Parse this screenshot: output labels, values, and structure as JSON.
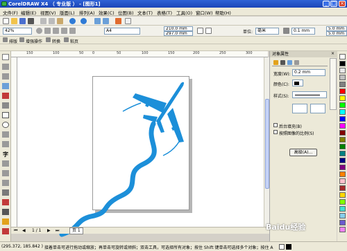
{
  "window": {
    "title": "CorelDRAW X4 （ 专业版 ） - [图形1]",
    "min": "_",
    "max": "□",
    "close": "×"
  },
  "menu": [
    "文件(F)",
    "编辑(E)",
    "视图(V)",
    "版面(L)",
    "排列(A)",
    "效果(C)",
    "位图(B)",
    "文本(T)",
    "表格(T)",
    "工具(O)",
    "窗口(W)",
    "帮助(H)"
  ],
  "toolbar2": {
    "zoom": "42%",
    "paper": "A4",
    "width": "210.0 mm",
    "height": "297.0 mm",
    "units_label": "单位:",
    "units": "毫米",
    "nudge": "0.1 mm",
    "dup_x": "5.0 mm",
    "dup_y": "5.0 mm"
  },
  "toolbar3": {
    "items": [
      "排版",
      "增强操作",
      "转换",
      "粘页"
    ]
  },
  "ruler_top": [
    "150",
    "100",
    "50",
    "0",
    "50",
    "100",
    "150",
    "200",
    "250",
    "300"
  ],
  "docker": {
    "title": "对象属性",
    "width_label": "宽度(W):",
    "width_value": "0.2 mm",
    "color_label": "颜色(C):",
    "style_label": "样式(S):",
    "checkbox1": "后台填充(B)",
    "checkbox2": "按照图像的比例(S)",
    "apply_button": "高级(A)..."
  },
  "page_nav": {
    "counter": "1 / 1",
    "page_tab": "页 1"
  },
  "status": {
    "coords": "(295.372, 185.842 )",
    "message": "接着单击可进行拖动或缩放；再单击可旋转或倾斜；双击工具，可选择所有对象；按住 Shift 键单击可选择多个对象；按住 Alt 键单..."
  },
  "watermark": "Baidu经验",
  "colors": {
    "drawing": "#1c8fd9",
    "titlebar": "#1b45b8"
  },
  "palette": [
    "#ffffff",
    "#000000",
    "#e8e8e8",
    "#c0c0c0",
    "#808080",
    "#ff0000",
    "#ffff00",
    "#00ff00",
    "#00ffff",
    "#0000ff",
    "#ff00ff",
    "#800000",
    "#808000",
    "#008000",
    "#008080",
    "#000080",
    "#800080",
    "#ff8000",
    "#ffc0cb",
    "#a52a2a",
    "#ffd700",
    "#7fff00",
    "#40e0d0",
    "#87ceeb",
    "#6a5acd",
    "#ee82ee"
  ]
}
